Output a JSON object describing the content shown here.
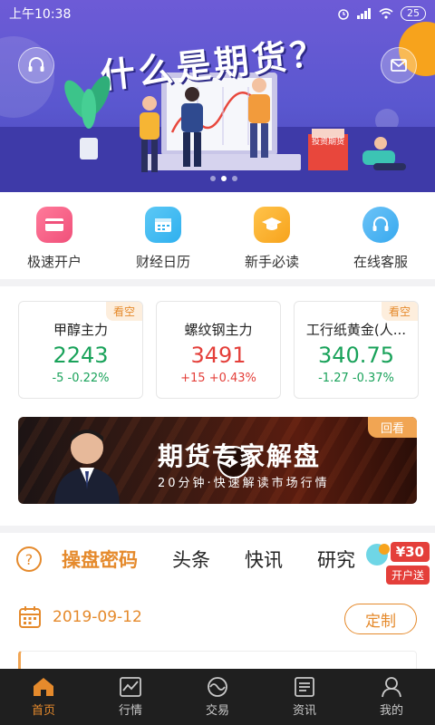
{
  "status_bar": {
    "time": "上午10:38",
    "battery": "25"
  },
  "banner": {
    "title": "什么是期货？",
    "book_label": "投资期货"
  },
  "quick_actions": [
    {
      "label": "极速开户",
      "icon": "card-icon",
      "color": "#f0507a"
    },
    {
      "label": "财经日历",
      "icon": "calendar-icon",
      "color": "#2fb0ef"
    },
    {
      "label": "新手必读",
      "icon": "graduation-cap-icon",
      "color": "#f7a31c"
    },
    {
      "label": "在线客服",
      "icon": "headset-icon",
      "color": "#37a9ef"
    }
  ],
  "quotes": [
    {
      "tag": "看空",
      "name": "甲醇主力",
      "price": "2243",
      "change": "-5",
      "percent": "-0.22%",
      "direction": "down"
    },
    {
      "tag": "",
      "name": "螺纹钢主力",
      "price": "3491",
      "change": "+15",
      "percent": "+0.43%",
      "direction": "up"
    },
    {
      "tag": "看空",
      "name": "工行纸黄金(人...",
      "price": "340.75",
      "change": "-1.27",
      "percent": "-0.37%",
      "direction": "down"
    }
  ],
  "live": {
    "tag": "回看",
    "title": "期货专家解盘",
    "subtitle": "20分钟·快速解读市场行情"
  },
  "tabs": [
    "操盘密码",
    "头条",
    "快讯",
    "研究"
  ],
  "promo": {
    "amount": "¥30",
    "label": "开户送"
  },
  "date": "2019-09-12",
  "custom_button": "定制",
  "bottom_nav": [
    {
      "label": "首页",
      "icon": "home-icon",
      "active": true
    },
    {
      "label": "行情",
      "icon": "chart-icon",
      "active": false
    },
    {
      "label": "交易",
      "icon": "trade-icon",
      "active": false
    },
    {
      "label": "资讯",
      "icon": "news-icon",
      "active": false
    },
    {
      "label": "我的",
      "icon": "user-icon",
      "active": false
    }
  ],
  "colors": {
    "accent": "#e58a2c",
    "up": "#e43f3a",
    "down": "#19a25a",
    "banner": "#5a57cf"
  }
}
